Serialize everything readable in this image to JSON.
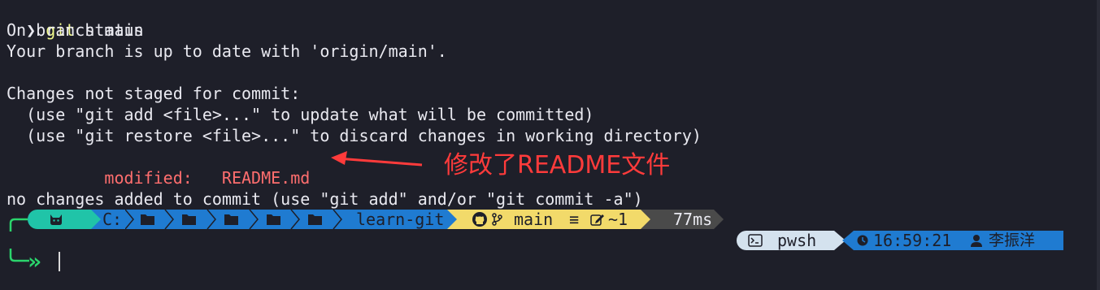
{
  "terminal": {
    "prompt_symbol": "❯",
    "command_name": "git",
    "command_args": " status",
    "output": {
      "branch_line": "On branch main",
      "uptodate_line": "Your branch is up to date with 'origin/main'.",
      "changes_header": "Changes not staged for commit:",
      "hint_add": "  (use \"git add <file>...\" to update what will be committed)",
      "hint_restore": "  (use \"git restore <file>...\" to discard changes in working directory)",
      "modified_label": "        modified:   ",
      "modified_file": "README.md",
      "no_changes_line": "no changes added to commit (use \"git add\" and/or \"git commit -a\")"
    }
  },
  "annotation": {
    "text": "修改了README文件",
    "color": "#ff3b3b"
  },
  "prompt_bar": {
    "os_icon": "cat-icon",
    "path_drive": "C:",
    "path_folder_count": 5,
    "path_folder_icon": "folder-icon",
    "path_current": "learn-git",
    "git_branch": "main",
    "git_status_symbol": "≡",
    "git_changes": "~1",
    "exec_time": "77ms"
  },
  "right_prompt": {
    "shell": "pwsh",
    "time": "16:59:21",
    "user": "李振洋"
  },
  "input_prompt": {
    "symbol": "»"
  },
  "colors": {
    "background": "#1e1f29",
    "os_segment": "#20c4a8",
    "path_segment": "#1f7bd1",
    "git_segment": "#f2da6a",
    "time_segment": "#4a4a4a",
    "shell_segment": "#d4e2ee",
    "accent_green": "#2bd46c"
  }
}
